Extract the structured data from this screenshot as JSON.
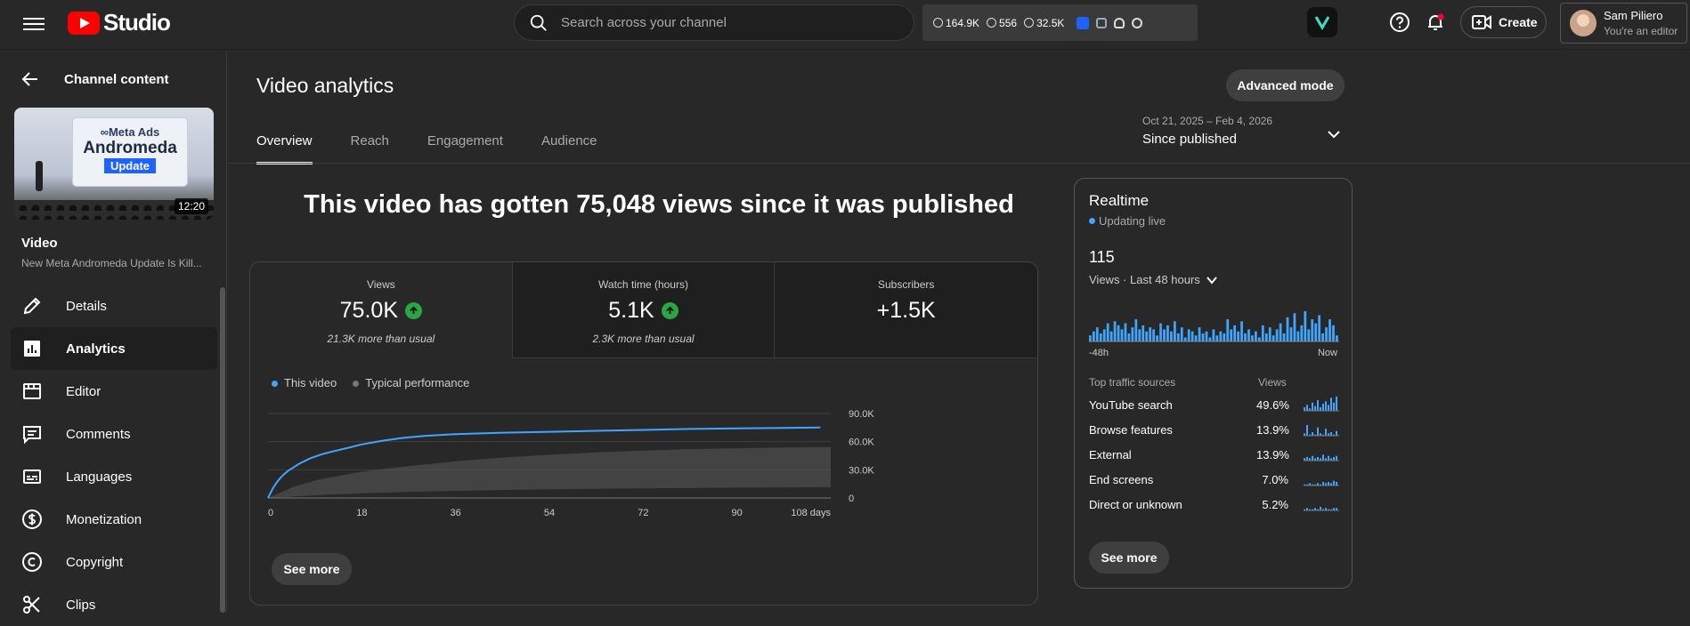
{
  "header": {
    "logo_text": "Studio",
    "search_placeholder": "Search across your channel",
    "extension_stats": [
      "164.9K",
      "556",
      "32.5K"
    ],
    "create_label": "Create",
    "account_name": "Sam Piliero",
    "account_role": "You're an editor"
  },
  "sidebar": {
    "back_label": "Channel content",
    "thumbnail": {
      "line1": "∞Meta Ads",
      "line2": "Andromeda",
      "line3": "Update",
      "duration": "12:20"
    },
    "video_label": "Video",
    "video_title": "New Meta Andromeda Update Is Kill...",
    "items": [
      {
        "label": "Details",
        "icon": "pencil-icon"
      },
      {
        "label": "Analytics",
        "icon": "analytics-icon"
      },
      {
        "label": "Editor",
        "icon": "editor-icon"
      },
      {
        "label": "Comments",
        "icon": "comments-icon"
      },
      {
        "label": "Languages",
        "icon": "subtitles-icon"
      },
      {
        "label": "Monetization",
        "icon": "dollar-icon"
      },
      {
        "label": "Copyright",
        "icon": "copyright-icon"
      },
      {
        "label": "Clips",
        "icon": "scissors-icon"
      }
    ],
    "active_item": "Analytics"
  },
  "main": {
    "title": "Video analytics",
    "advanced_mode_label": "Advanced mode",
    "date_range_small": "Oct 21, 2025 – Feb 4, 2026",
    "date_range_label": "Since published",
    "tabs": [
      "Overview",
      "Reach",
      "Engagement",
      "Audience"
    ],
    "active_tab": "Overview",
    "headline": "This video has gotten 75,048 views since it was published",
    "metrics": [
      {
        "label": "Views",
        "value": "75.0K",
        "note": "21.3K more than usual",
        "trend": "up"
      },
      {
        "label": "Watch time (hours)",
        "value": "5.1K",
        "note": "2.3K more than usual",
        "trend": "up"
      },
      {
        "label": "Subscribers",
        "value": "+1.5K",
        "note": "",
        "trend": ""
      }
    ],
    "legend": [
      "This video",
      "Typical performance"
    ],
    "see_more_label": "See more"
  },
  "chart_data": {
    "type": "line",
    "x_ticks": [
      "0",
      "18",
      "36",
      "54",
      "72",
      "90",
      "108 days"
    ],
    "y_ticks": [
      "90.0K",
      "60.0K",
      "30.0K",
      "0"
    ],
    "ylim": [
      0,
      90000
    ],
    "xlim": [
      0,
      108
    ],
    "series": [
      {
        "name": "This video",
        "type": "line",
        "color": "#3ea6ff",
        "x": [
          0,
          1,
          2,
          3,
          4,
          5,
          6,
          8,
          10,
          12,
          15,
          18,
          22,
          26,
          30,
          36,
          45,
          54,
          63,
          72,
          81,
          90,
          99,
          106
        ],
        "y": [
          0,
          11000,
          19000,
          25000,
          29500,
          33000,
          36500,
          42000,
          46000,
          49000,
          53000,
          57000,
          61000,
          64000,
          66000,
          68000,
          69500,
          70500,
          71500,
          72500,
          73500,
          74200,
          74700,
          75000
        ]
      },
      {
        "name": "Typical performance",
        "type": "band",
        "color": "#5a5a5a",
        "x": [
          0,
          5,
          10,
          18,
          27,
          36,
          45,
          54,
          63,
          72,
          81,
          90,
          99,
          108
        ],
        "upper": [
          0,
          12000,
          20000,
          28000,
          34000,
          39000,
          43000,
          46000,
          48500,
          50500,
          52000,
          53000,
          53800,
          54300
        ],
        "lower": [
          0,
          1500,
          3000,
          5000,
          6500,
          7500,
          8500,
          9200,
          9800,
          10200,
          10600,
          11000,
          11300,
          11500
        ]
      }
    ]
  },
  "realtime": {
    "title": "Realtime",
    "status": "Updating live",
    "count": "115",
    "period_label": "Views · Last 48 hours",
    "axis_start": "-48h",
    "axis_end": "Now",
    "bar_color": "#3ea6ff",
    "bars": [
      3,
      5,
      7,
      4,
      6,
      9,
      5,
      10,
      8,
      6,
      9,
      4,
      7,
      11,
      6,
      8,
      5,
      7,
      6,
      3,
      9,
      6,
      8,
      5,
      10,
      4,
      7,
      2,
      6,
      5,
      3,
      7,
      4,
      5,
      2,
      6,
      3,
      5,
      4,
      11,
      6,
      8,
      5,
      10,
      4,
      6,
      3,
      5,
      2,
      8,
      4,
      7,
      3,
      6,
      9,
      4,
      12,
      7,
      14,
      5,
      8,
      15,
      6,
      11,
      9,
      13,
      4,
      7,
      11,
      8,
      3
    ],
    "sources_header": "Top traffic sources",
    "sources_views_header": "Views",
    "sources": [
      {
        "name": "YouTube search",
        "pct": "49.6%",
        "spark": [
          3,
          5,
          2,
          7,
          4,
          9,
          3,
          6,
          8,
          5,
          11,
          7,
          12
        ]
      },
      {
        "name": "Browse features",
        "pct": "13.9%",
        "spark": [
          2,
          9,
          1,
          3,
          1,
          7,
          2,
          1,
          6,
          2,
          3,
          1,
          4
        ]
      },
      {
        "name": "External",
        "pct": "13.9%",
        "spark": [
          2,
          3,
          2,
          4,
          2,
          3,
          2,
          5,
          2,
          4,
          2,
          3,
          4
        ]
      },
      {
        "name": "End screens",
        "pct": "7.0%",
        "spark": [
          1,
          1,
          2,
          1,
          1,
          2,
          1,
          3,
          2,
          3,
          2,
          4,
          3
        ]
      },
      {
        "name": "Direct or unknown",
        "pct": "5.2%",
        "spark": [
          1,
          2,
          1,
          1,
          2,
          1,
          3,
          1,
          2,
          1,
          1,
          2,
          2
        ]
      }
    ],
    "see_more_label": "See more"
  }
}
